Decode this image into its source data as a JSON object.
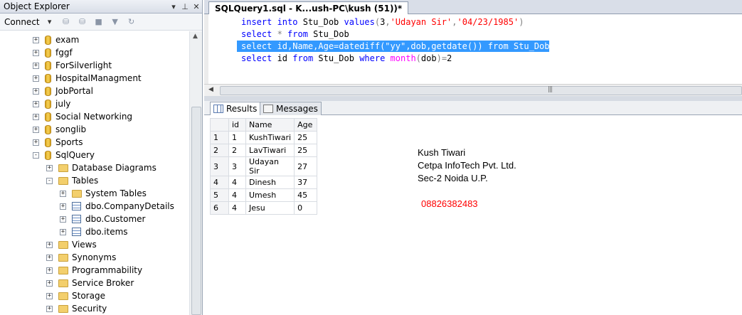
{
  "object_explorer": {
    "title": "Object Explorer",
    "connect_label": "Connect",
    "tree": [
      {
        "label": "exam",
        "kind": "db",
        "exp": "+"
      },
      {
        "label": "fggf",
        "kind": "db",
        "exp": "+"
      },
      {
        "label": "ForSilverlight",
        "kind": "db",
        "exp": "+"
      },
      {
        "label": "HospitalManagment",
        "kind": "db",
        "exp": "+"
      },
      {
        "label": "JobPortal",
        "kind": "db",
        "exp": "+"
      },
      {
        "label": "july",
        "kind": "db",
        "exp": "+"
      },
      {
        "label": "Social Networking",
        "kind": "db",
        "exp": "+"
      },
      {
        "label": "songlib",
        "kind": "db",
        "exp": "+"
      },
      {
        "label": "Sports",
        "kind": "db",
        "exp": "+"
      },
      {
        "label": "SqlQuery",
        "kind": "db",
        "exp": "-"
      },
      {
        "label": "Database Diagrams",
        "kind": "folder",
        "exp": "+"
      },
      {
        "label": "Tables",
        "kind": "folder",
        "exp": "-"
      },
      {
        "label": "System Tables",
        "kind": "folder",
        "exp": "+"
      },
      {
        "label": "dbo.CompanyDetails",
        "kind": "table",
        "exp": "+"
      },
      {
        "label": "dbo.Customer",
        "kind": "table",
        "exp": "+"
      },
      {
        "label": "dbo.items",
        "kind": "table",
        "exp": "+"
      },
      {
        "label": "Views",
        "kind": "folder",
        "exp": "+"
      },
      {
        "label": "Synonyms",
        "kind": "folder",
        "exp": "+"
      },
      {
        "label": "Programmability",
        "kind": "folder",
        "exp": "+"
      },
      {
        "label": "Service Broker",
        "kind": "folder",
        "exp": "+"
      },
      {
        "label": "Storage",
        "kind": "folder",
        "exp": "+"
      },
      {
        "label": "Security",
        "kind": "folder",
        "exp": "+"
      }
    ]
  },
  "editor": {
    "tab_title": "SQLQuery1.sql - K...ush-PC\\kush (51))*",
    "lines": [
      [
        [
          "kw",
          "insert into "
        ],
        [
          "",
          "Stu_Dob "
        ],
        [
          "kw",
          "values"
        ],
        [
          "gr",
          "("
        ],
        [
          "",
          "3"
        ],
        [
          "gr",
          ","
        ],
        [
          "st",
          "'Udayan Sir'"
        ],
        [
          "gr",
          ","
        ],
        [
          "st",
          "'04/23/1985'"
        ],
        [
          "gr",
          ")"
        ]
      ],
      [
        [
          "kw",
          "select "
        ],
        [
          "gr",
          "* "
        ],
        [
          "kw",
          "from "
        ],
        [
          "",
          "Stu_Dob"
        ]
      ],
      [
        [
          "",
          "select id,Name,Age=datediff(\"yy\",dob,getdate()) from Stu_Dob"
        ]
      ],
      [
        [
          "kw",
          "select "
        ],
        [
          "",
          "id "
        ],
        [
          "kw",
          "from "
        ],
        [
          "",
          "Stu_Dob "
        ],
        [
          "kw",
          "where "
        ],
        [
          "fn",
          "month"
        ],
        [
          "gr",
          "("
        ],
        [
          "",
          "dob"
        ],
        [
          "gr",
          ")="
        ],
        [
          "",
          "2"
        ]
      ]
    ],
    "selected_line": 2
  },
  "results": {
    "tab_results": "Results",
    "tab_messages": "Messages",
    "columns": [
      "id",
      "Name",
      "Age"
    ],
    "rows": [
      [
        "1",
        "KushTiwari",
        "25"
      ],
      [
        "2",
        "LavTiwari",
        "25"
      ],
      [
        "3",
        "Udayan Sir",
        "27"
      ],
      [
        "4",
        "Dinesh",
        "37"
      ],
      [
        "4",
        "Umesh",
        "45"
      ],
      [
        "4",
        "Jesu",
        "0"
      ]
    ]
  },
  "info": {
    "name": "Kush Tiwari",
    "company": "Cetpa  InfoTech Pvt. Ltd.",
    "address": "Sec-2 Noida U.P.",
    "phone": "08826382483",
    "phone_color": "#ff0000"
  }
}
